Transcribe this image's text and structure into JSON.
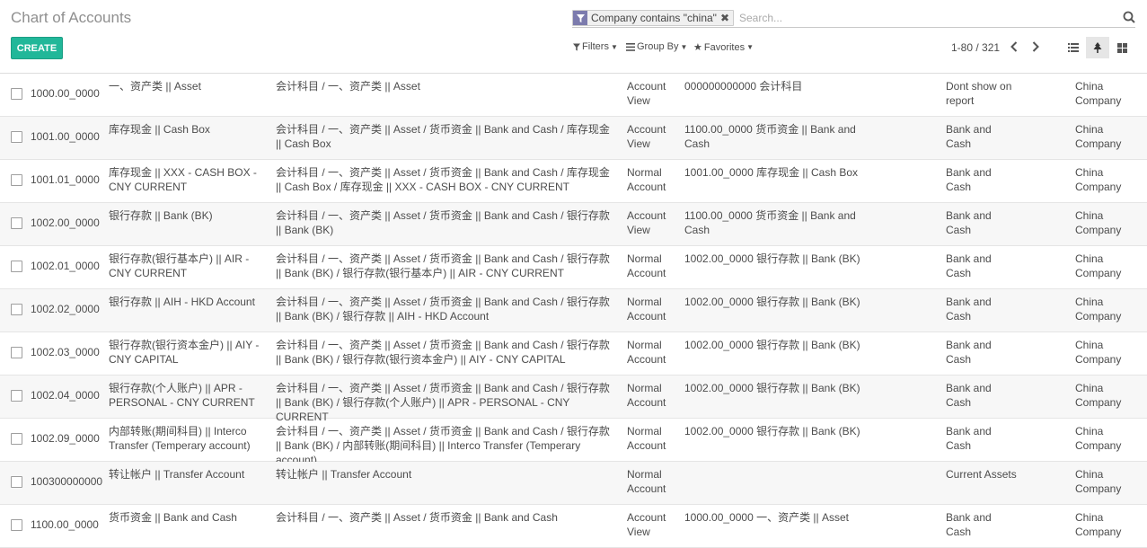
{
  "page": {
    "title": "Chart of Accounts"
  },
  "toolbar": {
    "create_label": "CREATE",
    "filters_label": "Filters",
    "groupby_label": "Group By",
    "favorites_label": "Favorites",
    "pager_text": "1-80 / 321"
  },
  "search": {
    "facet_text": "Company contains \"china\"",
    "facet_remove": "✖",
    "placeholder": "Search..."
  },
  "rows": [
    {
      "code": "1000.00_0000",
      "name": "一、资产类 || Asset",
      "path": "会计科目 / 一、资产类 || Asset",
      "type": "Account View",
      "parent": "000000000000 会计科目",
      "group": "Dont show on report",
      "company": "China Company"
    },
    {
      "code": "1001.00_0000",
      "name": "库存现金 || Cash Box",
      "path": "会计科目 / 一、资产类 || Asset / 货币资金 || Bank and Cash / 库存现金 || Cash Box",
      "type": "Account View",
      "parent": "1100.00_0000 货币资金 || Bank and Cash",
      "group": "Bank and Cash",
      "company": "China Company"
    },
    {
      "code": "1001.01_0000",
      "name": "库存现金 || XXX - CASH BOX - CNY CURRENT",
      "path": "会计科目 / 一、资产类 || Asset / 货币资金 || Bank and Cash / 库存现金 || Cash Box / 库存现金 || XXX - CASH BOX - CNY CURRENT",
      "type": "Normal Account",
      "parent": "1001.00_0000 库存现金 || Cash Box",
      "group": "Bank and Cash",
      "company": "China Company"
    },
    {
      "code": "1002.00_0000",
      "name": "银行存款 || Bank (BK)",
      "path": "会计科目 / 一、资产类 || Asset / 货币资金 || Bank and Cash / 银行存款 || Bank (BK)",
      "type": "Account View",
      "parent": "1100.00_0000 货币资金 || Bank and Cash",
      "group": "Bank and Cash",
      "company": "China Company"
    },
    {
      "code": "1002.01_0000",
      "name": "银行存款(银行基本户) || AIR - CNY CURRENT",
      "path": "会计科目 / 一、资产类 || Asset / 货币资金 || Bank and Cash / 银行存款 || Bank (BK) / 银行存款(银行基本户) || AIR - CNY CURRENT",
      "type": "Normal Account",
      "parent": "1002.00_0000 银行存款 || Bank (BK)",
      "group": "Bank and Cash",
      "company": "China Company"
    },
    {
      "code": "1002.02_0000",
      "name": "银行存款 || AIH - HKD Account",
      "path": "会计科目 / 一、资产类 || Asset / 货币资金 || Bank and Cash / 银行存款 || Bank (BK) / 银行存款 || AIH - HKD Account",
      "type": "Normal Account",
      "parent": "1002.00_0000 银行存款 || Bank (BK)",
      "group": "Bank and Cash",
      "company": "China Company"
    },
    {
      "code": "1002.03_0000",
      "name": "银行存款(银行资本金户) || AIY - CNY CAPITAL",
      "path": "会计科目 / 一、资产类 || Asset / 货币资金 || Bank and Cash / 银行存款 || Bank (BK) / 银行存款(银行资本金户) || AIY - CNY CAPITAL",
      "type": "Normal Account",
      "parent": "1002.00_0000 银行存款 || Bank (BK)",
      "group": "Bank and Cash",
      "company": "China Company"
    },
    {
      "code": "1002.04_0000",
      "name": "银行存款(个人账户) || APR - PERSONAL - CNY CURRENT",
      "path": "会计科目 / 一、资产类 || Asset / 货币资金 || Bank and Cash / 银行存款 || Bank (BK) / 银行存款(个人账户) || APR - PERSONAL - CNY CURRENT",
      "type": "Normal Account",
      "parent": "1002.00_0000 银行存款 || Bank (BK)",
      "group": "Bank and Cash",
      "company": "China Company"
    },
    {
      "code": "1002.09_0000",
      "name": "内部转账(期间科目) || Interco Transfer (Temperary account)",
      "path": "会计科目 / 一、资产类 || Asset / 货币资金 || Bank and Cash / 银行存款 || Bank (BK) / 内部转账(期间科目) || Interco Transfer (Temperary account)",
      "type": "Normal Account",
      "parent": "1002.00_0000 银行存款 || Bank (BK)",
      "group": "Bank and Cash",
      "company": "China Company"
    },
    {
      "code": "100300000000",
      "name": "转让帐户 || Transfer Account",
      "path": "转让帐户 || Transfer Account",
      "type": "Normal Account",
      "parent": "",
      "group": "Current Assets",
      "company": "China Company"
    },
    {
      "code": "1100.00_0000",
      "name": "货币资金 || Bank and Cash",
      "path": "会计科目 / 一、资产类 || Asset / 货币资金 || Bank and Cash",
      "type": "Account View",
      "parent": "1000.00_0000 一、资产类 || Asset",
      "group": "Bank and Cash",
      "company": "China Company"
    }
  ]
}
